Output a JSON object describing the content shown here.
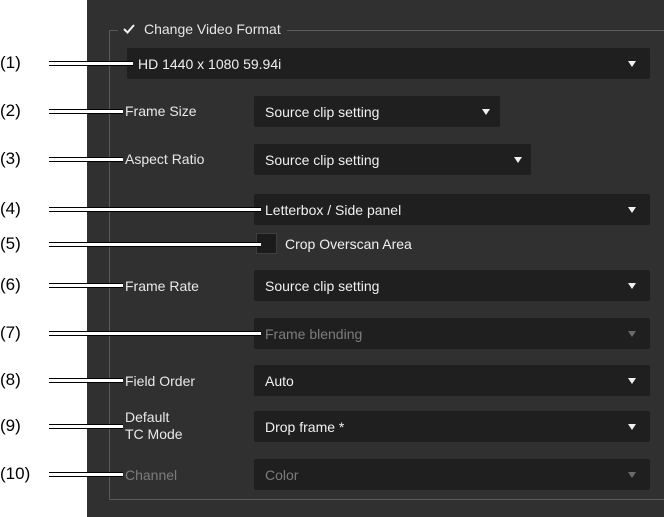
{
  "dialog": {
    "group_title": "Change Video Format",
    "group_checked": true
  },
  "video_format": {
    "value": "HD 1440 x 1080 59.94i"
  },
  "frame_size": {
    "label": "Frame Size",
    "value": "Source clip setting"
  },
  "aspect_ratio": {
    "label": "Aspect Ratio",
    "value": "Source clip setting"
  },
  "aspect_conversion": {
    "value": "Letterbox / Side panel"
  },
  "crop_overscan": {
    "label": "Crop Overscan Area",
    "checked": false
  },
  "frame_rate": {
    "label": "Frame Rate",
    "value": "Source clip setting"
  },
  "frame_rate_conversion": {
    "value": "Frame blending",
    "disabled": true
  },
  "field_order": {
    "label": "Field Order",
    "value": "Auto"
  },
  "default_tc_mode": {
    "label_line1": "Default",
    "label_line2": "TC Mode",
    "value": "Drop frame *"
  },
  "channel": {
    "label": "Channel",
    "value": "Color",
    "disabled": true
  },
  "callouts": [
    "(1)",
    "(2)",
    "(3)",
    "(4)",
    "(5)",
    "(6)",
    "(7)",
    "(8)",
    "(9)",
    "(10)"
  ],
  "colors": {
    "panel_background": "#303030",
    "dropdown_background": "#1f1f1f",
    "text": "#f0f0f0",
    "disabled_text": "#7c7c7c",
    "callout_text": "#000000"
  }
}
